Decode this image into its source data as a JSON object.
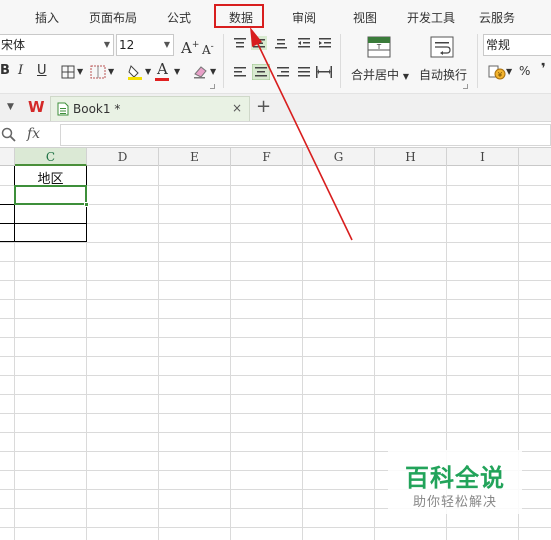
{
  "menu": {
    "items": [
      "插入",
      "页面布局",
      "公式",
      "数据",
      "审阅",
      "视图",
      "开发工具",
      "云服务"
    ],
    "highlighted": "数据",
    "highlight_color": "#d81e1e"
  },
  "ribbon": {
    "font_name": "宋体",
    "font_size": "12",
    "grow_font": "A",
    "shrink_font": "A",
    "bold": "B",
    "italic": "I",
    "underline": "U",
    "font_color_letter": "A",
    "merge_center_label": "合并居中",
    "wrap_text_label": "自动换行",
    "number_format": "常规",
    "percent": "%",
    "comma_style": "❜"
  },
  "tabbar": {
    "book_name": "Book1 *",
    "close": "×",
    "new_tab": "+",
    "wps_logo": "W"
  },
  "formula_bar": {
    "fx": "fx",
    "value": ""
  },
  "sheet": {
    "columns": [
      "C",
      "D",
      "E",
      "F",
      "G",
      "H",
      "I"
    ],
    "active_column": "C",
    "cells": {
      "C1": "地区"
    }
  },
  "watermark": {
    "title": "百科全说",
    "subtitle": "助你轻松解决"
  },
  "colors": {
    "accent_green": "#3d8f3a",
    "arrow_red": "#d81e1e",
    "watermark_green": "#22a35a"
  }
}
